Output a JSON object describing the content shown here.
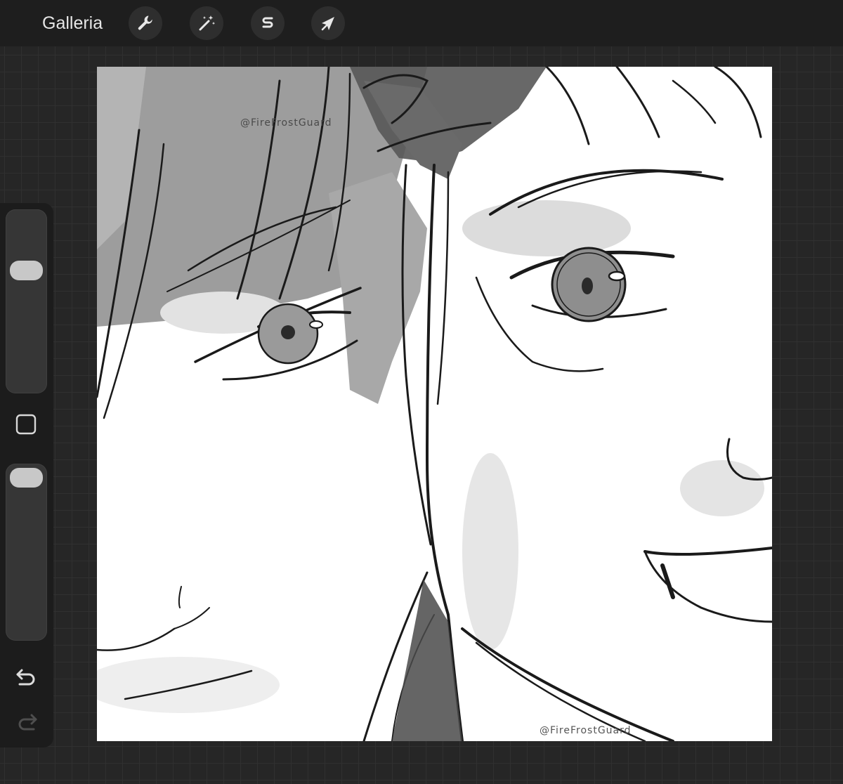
{
  "topbar": {
    "gallery_label": "Galleria",
    "tools": [
      {
        "icon": "wrench-icon",
        "action": "actions"
      },
      {
        "icon": "magic-wand-icon",
        "action": "adjustments"
      },
      {
        "icon": "selection-s-icon",
        "action": "selection"
      },
      {
        "icon": "arrow-cursor-icon",
        "action": "transform"
      }
    ]
  },
  "canvas": {
    "watermark_top": "@FireFrostGuard",
    "watermark_bottom": "@FireFrostGuard"
  },
  "sidebar": {
    "brush_size_level": 0.7,
    "opacity_level": 1.0,
    "modify_icon": "square-modify-icon",
    "undo_icon": "undo-icon",
    "redo_icon": "redo-icon",
    "redo_enabled": false
  },
  "colors": {
    "ui_background": "#262626",
    "topbar": "#1e1e1e",
    "sidebar": "#1c1c1c",
    "canvas": "#ffffff",
    "ink": "#1a1a1a"
  }
}
